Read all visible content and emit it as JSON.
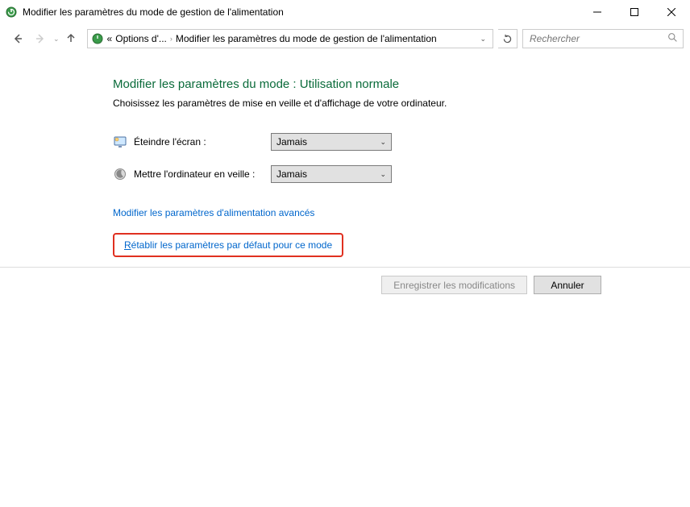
{
  "window": {
    "title": "Modifier les paramètres du mode de gestion de l'alimentation"
  },
  "nav": {
    "crumb_prefix": "«",
    "crumb1": "Options d'...",
    "crumb2": "Modifier les paramètres du mode de gestion de l'alimentation",
    "search_placeholder": "Rechercher"
  },
  "main": {
    "heading": "Modifier les paramètres du mode : Utilisation normale",
    "subtext": "Choisissez les paramètres de mise en veille et d'affichage de votre ordinateur.",
    "row1_label": "Éteindre l'écran :",
    "row1_value": "Jamais",
    "row2_label": "Mettre l'ordinateur en veille :",
    "row2_value": "Jamais",
    "link_advanced": "Modifier les paramètres d'alimentation avancés",
    "link_restore": "Rétablir les paramètres par défaut pour ce mode"
  },
  "footer": {
    "save": "Enregistrer les modifications",
    "cancel": "Annuler"
  }
}
